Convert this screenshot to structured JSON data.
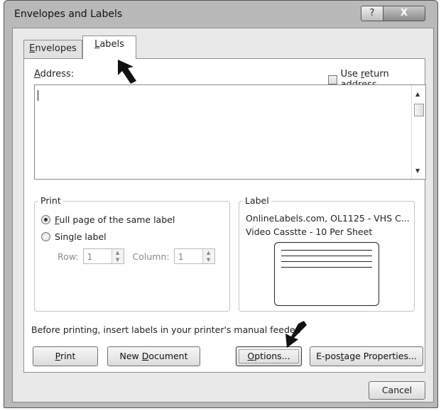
{
  "window": {
    "title": "Envelopes and Labels",
    "help_glyph": "?",
    "close_glyph": "X"
  },
  "tabs": [
    {
      "label": "Envelopes",
      "selected": false
    },
    {
      "label": "Labels",
      "selected": true
    }
  ],
  "address": {
    "label": "Address:",
    "value": "",
    "use_return_address": {
      "label": "Use return address",
      "checked": false
    }
  },
  "print_group": {
    "legend": "Print",
    "options": [
      {
        "label": "Full page of the same label",
        "selected": true
      },
      {
        "label": "Single label",
        "selected": false
      }
    ],
    "row": {
      "label": "Row:",
      "value": "1"
    },
    "column": {
      "label": "Column:",
      "value": "1"
    }
  },
  "label_group": {
    "legend": "Label",
    "line1": "OnlineLabels.com, OL1125 - VHS C...",
    "line2": "Video Casstte - 10 Per Sheet"
  },
  "note": "Before printing, insert labels in your printer's manual feeder.",
  "buttons": {
    "print": "Print",
    "new_document": "New Document",
    "options": "Options...",
    "epostage": "E-postage Properties...",
    "cancel": "Cancel"
  }
}
